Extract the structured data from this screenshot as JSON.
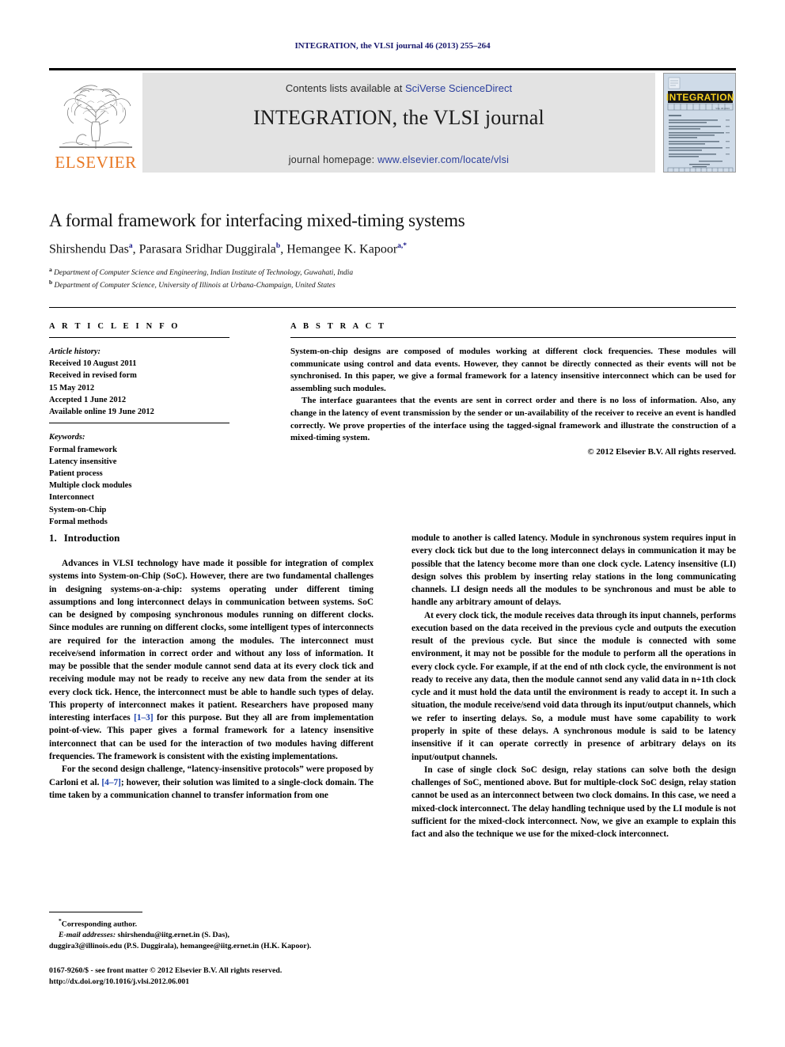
{
  "running_head": "INTEGRATION, the VLSI journal 46 (2013) 255–264",
  "masthead": {
    "contents_prefix": "Contents lists available at ",
    "contents_link": "SciVerse ScienceDirect",
    "journal_title": "INTEGRATION, the VLSI journal",
    "homepage_prefix": "journal homepage: ",
    "homepage_link": "www.elsevier.com/locate/vlsi",
    "publisher_wordmark": "ELSEVIER",
    "cover_banner": "INTEGRATION"
  },
  "title": "A formal framework for interfacing mixed-timing systems",
  "authors": [
    {
      "name": "Shirshendu Das",
      "marks": "a"
    },
    {
      "name": "Parasara Sridhar Duggirala",
      "marks": "b"
    },
    {
      "name": "Hemangee K. Kapoor",
      "marks": "a,*"
    }
  ],
  "affiliations": [
    {
      "mark": "a",
      "text": "Department of Computer Science and Engineering, Indian Institute of Technology, Guwahati, India"
    },
    {
      "mark": "b",
      "text": "Department of Computer Science, University of Illinois at Urbana-Champaign, United States"
    }
  ],
  "article_info": {
    "heading": "A R T I C L E   I N F O",
    "history_label": "Article history:",
    "history": [
      "Received 10 August 2011",
      "Received in revised form",
      "15 May 2012",
      "Accepted 1 June 2012",
      "Available online 19 June 2012"
    ],
    "keywords_label": "Keywords:",
    "keywords": [
      "Formal framework",
      "Latency insensitive",
      "Patient process",
      "Multiple clock modules",
      "Interconnect",
      "System-on-Chip",
      "Formal methods"
    ]
  },
  "abstract": {
    "heading": "A B S T R A C T",
    "paragraphs": [
      "System-on-chip designs are composed of modules working at different clock frequencies. These modules will communicate using control and data events. However, they cannot be directly connected as their events will not be synchronised. In this paper, we give a formal framework for a latency insensitive interconnect which can be used for assembling such modules.",
      "The interface guarantees that the events are sent in correct order and there is no loss of information. Also, any change in the latency of event transmission by the sender or un-availability of the receiver to receive an event is handled correctly. We prove properties of the interface using the tagged-signal framework and illustrate the construction of a mixed-timing system."
    ],
    "copyright": "© 2012 Elsevier B.V. All rights reserved."
  },
  "section": {
    "number": "1.",
    "heading": "Introduction"
  },
  "body": {
    "left": [
      "Advances in VLSI technology have made it possible for integration of complex systems into System-on-Chip (SoC). However, there are two fundamental challenges in designing systems-on-a-chip: systems operating under different timing assumptions and long interconnect delays in communication between systems. SoC can be designed by composing synchronous modules running on different clocks. Since modules are running on different clocks, some intelligent types of interconnects are required for the interaction among the modules. The interconnect must receive/send information in correct order and without any loss of information. It may be possible that the sender module cannot send data at its every clock tick and receiving module may not be ready to receive any new data from the sender at its every clock tick. Hence, the interconnect must be able to handle such types of delay. This property of interconnect makes it patient. Researchers have proposed many interesting interfaces [1–3] for this purpose. But they all are from implementation point-of-view. This paper gives a formal framework for a latency insensitive interconnect that can be used for the interaction of two modules having different frequencies. The framework is consistent with the existing implementations.",
      "For the second design challenge, “latency-insensitive protocols” were proposed by Carloni et al. [4–7]; however, their solution was limited to a single-clock domain. The time taken by a communication channel to transfer information from one"
    ],
    "right": [
      "module to another is called latency. Module in synchronous system requires input in every clock tick but due to the long interconnect delays in communication it may be possible that the latency become more than one clock cycle. Latency insensitive (LI) design solves this problem by inserting relay stations in the long communicating channels. LI design needs all the modules to be synchronous and must be able to handle any arbitrary amount of delays.",
      "At every clock tick, the module receives data through its input channels, performs execution based on the data received in the previous cycle and outputs the execution result of the previous cycle. But since the module is connected with some environment, it may not be possible for the module to perform all the operations in every clock cycle. For example, if at the end of nth clock cycle, the environment is not ready to receive any data, then the module cannot send any valid data in n+1th clock cycle and it must hold the data until the environment is ready to accept it. In such a situation, the module receive/send void data through its input/output channels, which we refer to inserting delays. So, a module must have some capability to work properly in spite of these delays. A synchronous module is said to be latency insensitive if it can operate correctly in presence of arbitrary delays on its input/output channels.",
      "In case of single clock SoC design, relay stations can solve both the design challenges of SoC, mentioned above. But for multiple-clock SoC design, relay station cannot be used as an interconnect between two clock domains. In this case, we need a mixed-clock interconnect. The delay handling technique used by the LI module is not sufficient for the mixed-clock interconnect. Now, we give an example to explain this fact and also the technique we use for the mixed-clock interconnect."
    ]
  },
  "footnote": {
    "corresponding": "Corresponding author.",
    "email_label": "E-mail addresses:",
    "email_line_1": "shirshendu@iitg.ernet.in (S. Das),",
    "email_line_2": "duggira3@illinois.edu (P.S. Duggirala), hemangee@iitg.ernet.in (H.K. Kapoor)."
  },
  "issn": {
    "line1": "0167-9260/$ - see front matter © 2012 Elsevier B.V. All rights reserved.",
    "line2": "http://dx.doi.org/10.1016/j.vlsi.2012.06.001"
  },
  "colors": {
    "link_blue": "#2b3f9e",
    "running_head_navy": "#1a1a6e",
    "elsevier_orange": "#e87722",
    "band_gray": "#e3e3e3",
    "reference_blue": "#1a3faa",
    "cover_blue": "#cfdbe8"
  }
}
